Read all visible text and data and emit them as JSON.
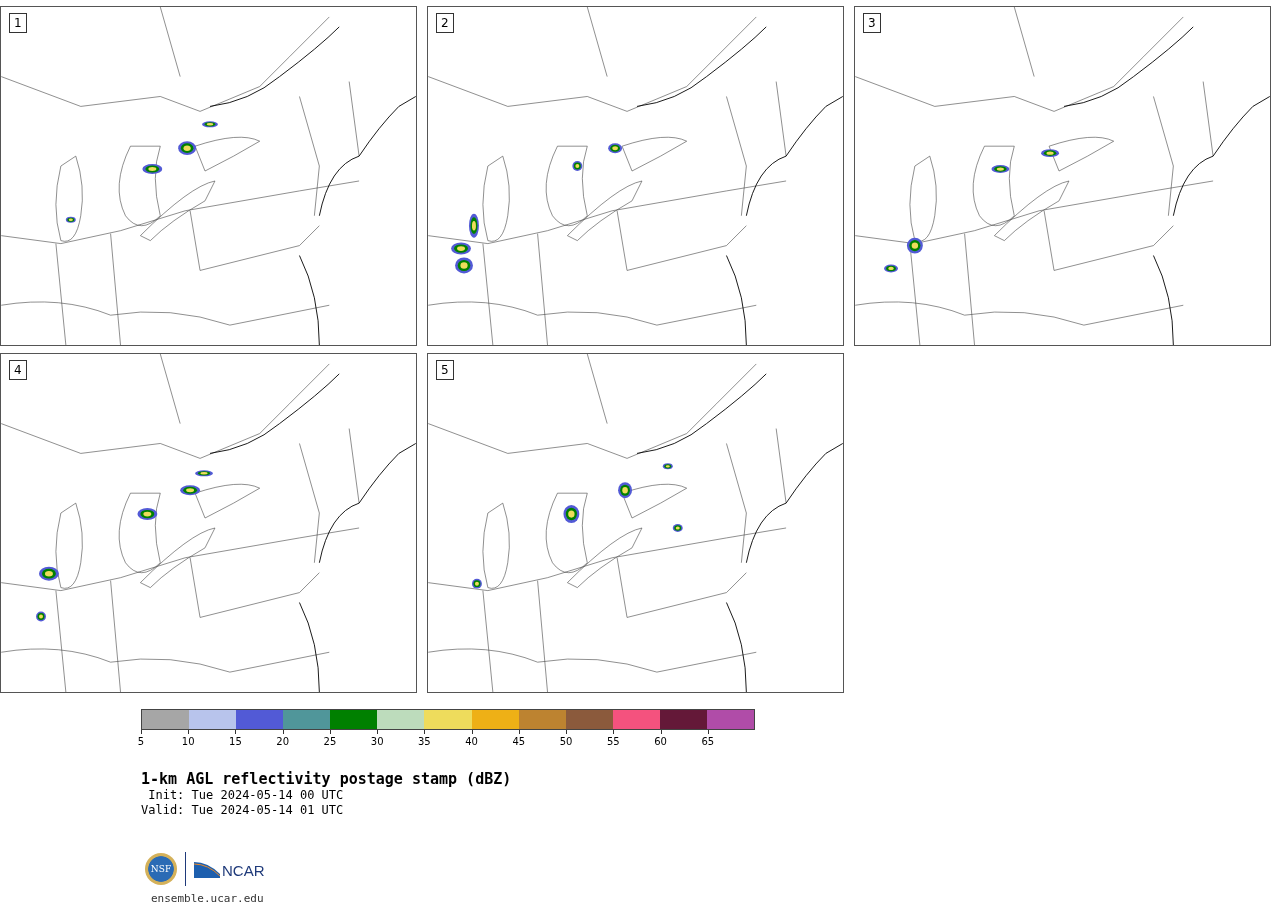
{
  "panels": [
    {
      "label": "1"
    },
    {
      "label": "2"
    },
    {
      "label": "3"
    },
    {
      "label": "4"
    },
    {
      "label": "5"
    }
  ],
  "colorbar": {
    "bins": [
      {
        "color": "#a6a6a6"
      },
      {
        "color": "#b8c4ec"
      },
      {
        "color": "#525ad6"
      },
      {
        "color": "#50969a"
      },
      {
        "color": "#008000"
      },
      {
        "color": "#bddcbc"
      },
      {
        "color": "#eedc5c"
      },
      {
        "color": "#eeb016"
      },
      {
        "color": "#bd8330"
      },
      {
        "color": "#8b5a3c"
      },
      {
        "color": "#f4527e"
      },
      {
        "color": "#641838"
      },
      {
        "color": "#b04ca8"
      }
    ],
    "ticks": [
      "5",
      "10",
      "15",
      "20",
      "25",
      "30",
      "35",
      "40",
      "45",
      "50",
      "55",
      "60",
      "65"
    ]
  },
  "title": "1-km AGL reflectivity postage stamp (dBZ)",
  "init": "Init: Tue 2024-05-14 00 UTC",
  "valid": "Valid: Tue 2024-05-14 01 UTC",
  "logos": {
    "nsf": "NSF",
    "ncar": "NCAR"
  },
  "url": "ensemble.ucar.edu"
}
